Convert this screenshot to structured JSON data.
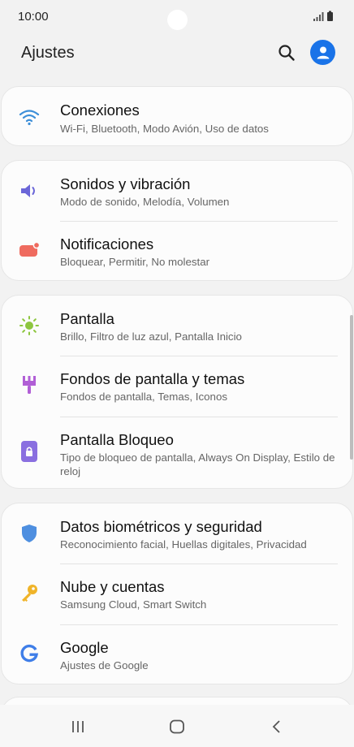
{
  "status_bar": {
    "time": "10:00"
  },
  "header": {
    "title": "Ajustes"
  },
  "groups": [
    {
      "items": [
        {
          "title": "Conexiones",
          "subtitle": "Wi-Fi, Bluetooth, Modo Avión, Uso de datos",
          "icon": "wifi-icon",
          "color": "#3d8fd8"
        }
      ]
    },
    {
      "items": [
        {
          "title": "Sonidos y vibración",
          "subtitle": "Modo de sonido, Melodía, Volumen",
          "icon": "speaker-icon",
          "color": "#6b66d8"
        },
        {
          "title": "Notificaciones",
          "subtitle": "Bloquear, Permitir, No molestar",
          "icon": "notification-icon",
          "color": "#ef6b5f"
        }
      ]
    },
    {
      "items": [
        {
          "title": "Pantalla",
          "subtitle": "Brillo, Filtro de luz azul, Pantalla Inicio",
          "icon": "brightness-icon",
          "color": "#8dc63f"
        },
        {
          "title": "Fondos de pantalla y temas",
          "subtitle": "Fondos de pantalla, Temas, Iconos",
          "icon": "paintbrush-icon",
          "color": "#b15fd6"
        },
        {
          "title": "Pantalla Bloqueo",
          "subtitle": "Tipo de bloqueo de pantalla, Always On Display, Estilo de reloj",
          "icon": "lock-screen-icon",
          "color": "#8a6fe0"
        }
      ]
    },
    {
      "items": [
        {
          "title": "Datos biométricos y seguridad",
          "subtitle": "Reconocimiento facial, Huellas digitales, Privacidad",
          "icon": "shield-icon",
          "color": "#4e8fe0"
        },
        {
          "title": "Nube y cuentas",
          "subtitle": "Samsung Cloud, Smart Switch",
          "icon": "key-icon",
          "color": "#f0b429"
        },
        {
          "title": "Google",
          "subtitle": "Ajustes de Google",
          "icon": "google-icon",
          "color": "#3f7ee8"
        }
      ]
    }
  ]
}
